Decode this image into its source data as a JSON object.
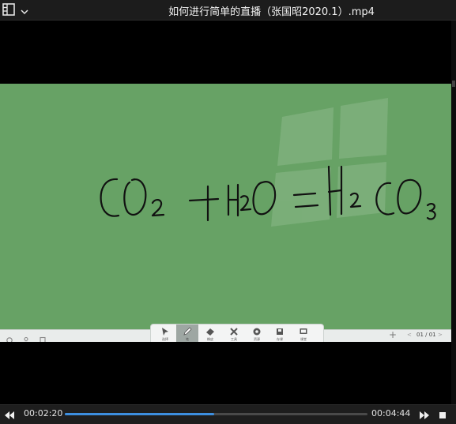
{
  "window": {
    "title": "如何进行简单的直播（张国昭2020.1）.mp4"
  },
  "board": {
    "background": "#67a265",
    "ink_color": "#111111",
    "handwritten_text": "CO₂ + H₂O = H₂CO₃"
  },
  "toolbar": {
    "tools": [
      {
        "label": "选择",
        "icon": "cursor-icon"
      },
      {
        "label": "笔",
        "icon": "pen-icon"
      },
      {
        "label": "橡皮",
        "icon": "eraser-icon"
      },
      {
        "label": "工具",
        "icon": "tools-icon"
      },
      {
        "label": "资源",
        "icon": "resource-icon"
      },
      {
        "label": "存课",
        "icon": "save-icon"
      },
      {
        "label": "课堂",
        "icon": "classroom-icon"
      }
    ],
    "active_tool": 1
  },
  "pager": {
    "add": "+",
    "prev": "<",
    "count": "01 / 01",
    "next": ">"
  },
  "player": {
    "current_time": "00:02:20",
    "total_time": "00:04:44",
    "progress": 0.493,
    "accent": "#3d8fe0"
  }
}
